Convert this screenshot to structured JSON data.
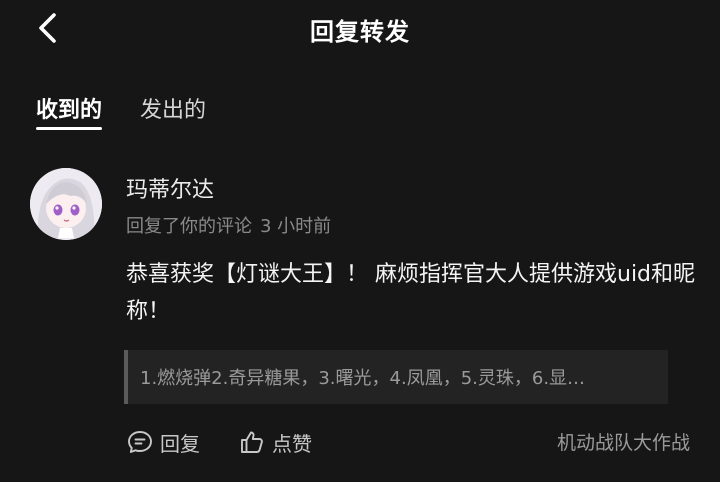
{
  "header": {
    "title": "回复转发",
    "back_icon": "chevron-left-icon"
  },
  "tabs": [
    {
      "label": "收到的",
      "active": true
    },
    {
      "label": "发出的",
      "active": false
    }
  ],
  "reply": {
    "author": "玛蒂尔达",
    "action": "回复了你的评论",
    "time": "3 小时前",
    "content": "恭喜获奖【灯谜大王】！ 麻烦指挥官大人提供游戏uid和昵称！",
    "quote": "1.燃烧弹2.奇异糖果，3.曙光，4.凤凰，5.灵珠，6.显…",
    "reply_label": "回复",
    "like_label": "点赞",
    "source": "机动战队大作战"
  },
  "colors": {
    "background": "#161616",
    "muted": "#8a8a8a",
    "quote_bg": "#232323"
  }
}
